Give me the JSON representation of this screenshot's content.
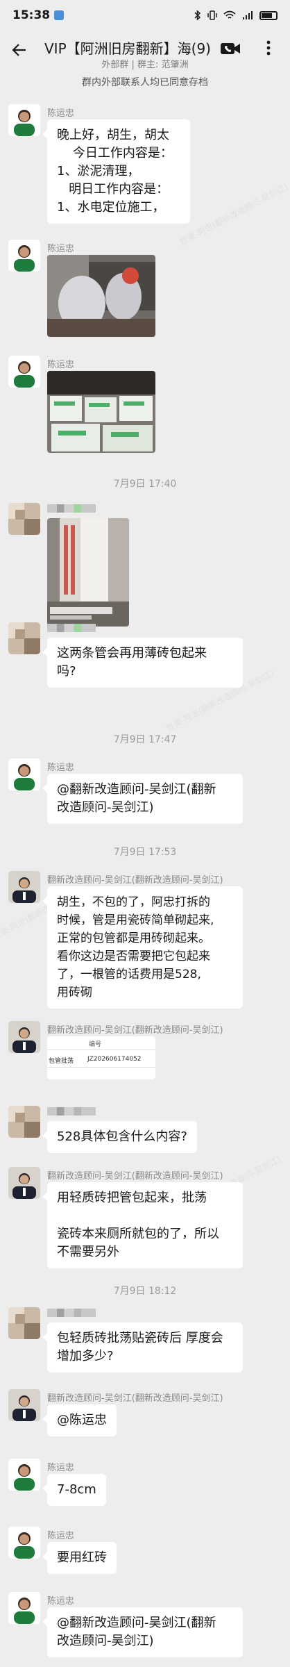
{
  "status": {
    "time": "15:38",
    "battery": "battery-icon",
    "signal": "signal-icon",
    "wifi": "wifi-icon"
  },
  "header": {
    "title": "VIP【阿洲旧房翻新】海(9)",
    "subtitle": "外部群 | 群主: 范肇洲",
    "notice": "群内外部联系人均已同意存档"
  },
  "watermark": "贺荣-阿忠(翻新改造顾问-吴剑江)",
  "messages": [
    {
      "sender": "陈运忠",
      "lines": [
        "晚上好，胡生，胡太",
        "    今日工作内容是：",
        "1、淤泥清理，",
        "   明日工作内容是：",
        "1、水电定位施工，"
      ]
    },
    {
      "sender": "陈运忠",
      "image": "construction-photo"
    },
    {
      "sender": "陈运忠",
      "image": "tiles-photo"
    },
    {
      "timestamp": "7月9日  17:40"
    },
    {
      "sender": "",
      "image": "pipes-photo"
    },
    {
      "sender": "",
      "lines": [
        "这两条管会再用薄砖包起来",
        "吗?"
      ]
    },
    {
      "timestamp": "7月9日  17:47"
    },
    {
      "sender": "陈运忠",
      "lines": [
        "@翻新改造顾问-吴剑江(翻新",
        "改造顾问-吴剑江)"
      ]
    },
    {
      "timestamp": "7月9日  17:53"
    },
    {
      "sender": "翻新改造顾问-吴剑江(翻新改造顾问-吴剑江)",
      "lines": [
        "胡生，不包的了，阿忠打拆的",
        "时候，管是用瓷砖简单砌起来,",
        "正常的包管都是用砖砌起来。",
        "看你这边是否需要把它包起来",
        "了，一根管的话费用是528,",
        "用砖砌"
      ]
    },
    {
      "sender": "翻新改造顾问-吴剑江(翻新改造顾问-吴剑江)",
      "doc": {
        "label": "编号",
        "left": "包管批荡",
        "code": "JZ202606174052"
      }
    },
    {
      "sender": "",
      "lines": [
        "528具体包含什么内容?"
      ]
    },
    {
      "sender": "翻新改造顾问-吴剑江(翻新改造顾问-吴剑江)",
      "lines": [
        "用轻质砖把管包起来，批荡",
        "",
        "瓷砖本来厕所就包的了，所以",
        "不需要另外"
      ]
    },
    {
      "timestamp": "7月9日  18:12"
    },
    {
      "sender": "",
      "lines": [
        "包轻质砖批荡贴瓷砖后 厚度会",
        "增加多少?"
      ]
    },
    {
      "sender": "翻新改造顾问-吴剑江(翻新改造顾问-吴剑江)",
      "lines": [
        "@陈运忠"
      ]
    },
    {
      "sender": "陈运忠",
      "lines": [
        "7-8cm"
      ]
    },
    {
      "sender": "陈运忠",
      "lines": [
        "要用红砖"
      ]
    },
    {
      "sender": "陈运忠",
      "lines": [
        "@翻新改造顾问-吴剑江(翻新",
        "改造顾问-吴剑江)"
      ]
    }
  ]
}
